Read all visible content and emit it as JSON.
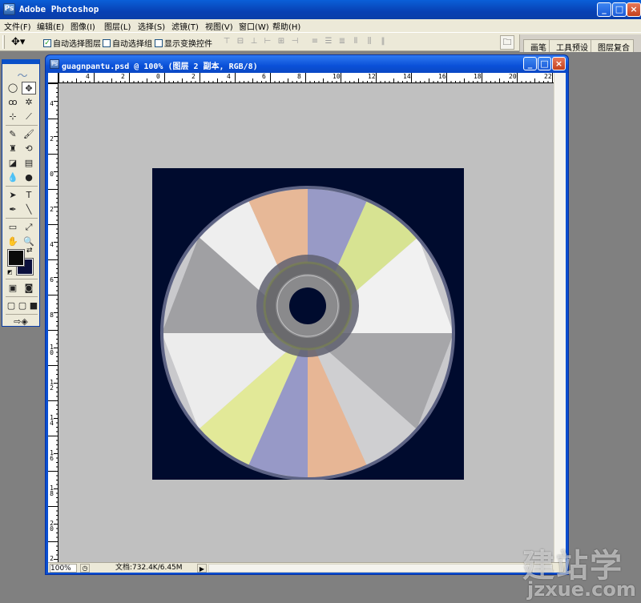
{
  "app": {
    "title": "Adobe Photoshop",
    "logo": "Ps"
  },
  "window_controls": {
    "minimize": "_",
    "maximize": "□",
    "close": "×"
  },
  "menu": [
    {
      "label": "文件(F)"
    },
    {
      "label": "编辑(E)"
    },
    {
      "label": "图像(I)"
    },
    {
      "label": "图层(L)"
    },
    {
      "label": "选择(S)"
    },
    {
      "label": "滤镜(T)"
    },
    {
      "label": "视图(V)"
    },
    {
      "label": "窗口(W)"
    },
    {
      "label": "帮助(H)"
    }
  ],
  "options_bar": {
    "tool_icon": "move-tool-icon",
    "auto_select_layer": {
      "label": "自动选择图层",
      "checked": true
    },
    "auto_select_group": {
      "label": "自动选择组",
      "checked": false
    },
    "show_transform_controls": {
      "label": "显示变换控件",
      "checked": false
    },
    "palette_tabs": [
      "画笔",
      "工具预设",
      "图层复合"
    ]
  },
  "document": {
    "title": "guagnpantu.psd @ 100% (图层 2 副本, RGB/8)",
    "zoom": "100%",
    "doc_size": "文档:732.4K/6.45M",
    "hruler_labels": [
      "4",
      "2",
      "0",
      "2",
      "4",
      "6",
      "8",
      "10",
      "12",
      "14",
      "16",
      "18",
      "20",
      "22"
    ],
    "vruler_labels": [
      "4",
      "2",
      "0",
      "2",
      "4",
      "6",
      "8",
      "10",
      "12",
      "14",
      "16",
      "18",
      "20",
      "2"
    ]
  },
  "colors": {
    "foreground": "#0a0a0a",
    "background": "#0a0f3c",
    "artboard": "#000b2e"
  },
  "watermark": {
    "big": "建站学",
    "small": "jzxue.com"
  }
}
